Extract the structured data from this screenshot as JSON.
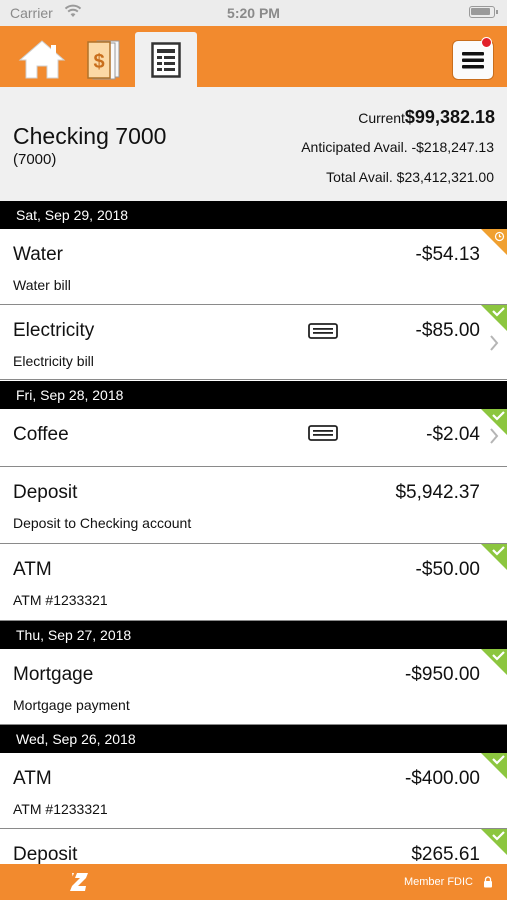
{
  "status_bar": {
    "carrier": "Carrier",
    "time": "5:20 PM"
  },
  "nav": {
    "icons": [
      "home-icon",
      "dollar-icon",
      "register-icon",
      "menu-icon"
    ],
    "accent_color": "#f28a2e",
    "notification_color": "#e2202a"
  },
  "account": {
    "name": "Checking 7000",
    "number": "(7000)",
    "current_label": "Current",
    "current_value": "$99,382.18",
    "anticipated": "Anticipated Avail. -$218,247.13",
    "total": "Total Avail. $23,412,321.00"
  },
  "dates": {
    "d1": "Sat, Sep 29, 2018",
    "d2": "Fri, Sep 28, 2018",
    "d3": "Thu, Sep 27, 2018",
    "d4": "Wed, Sep 26, 2018"
  },
  "transactions": [
    {
      "title": "Water",
      "memo": "Water bill",
      "amount": "-$54.13",
      "status": "pending"
    },
    {
      "title": "Electricity",
      "memo": "Electricity bill",
      "amount": "-$85.00",
      "status": "cleared"
    },
    {
      "title": "Coffee",
      "memo": "",
      "amount": "-$2.04",
      "status": "cleared"
    },
    {
      "title": "Deposit",
      "memo": "Deposit to Checking account",
      "amount": "$5,942.37",
      "status": "none"
    },
    {
      "title": "ATM",
      "memo": "ATM #1233321",
      "amount": "-$50.00",
      "status": "cleared"
    },
    {
      "title": "Mortgage",
      "memo": "Mortgage payment",
      "amount": "-$950.00",
      "status": "cleared"
    },
    {
      "title": "ATM",
      "memo": "ATM #1233321",
      "amount": "-$400.00",
      "status": "cleared"
    },
    {
      "title": "Deposit",
      "memo": "",
      "amount": "$265.61",
      "status": "cleared"
    }
  ],
  "status_colors": {
    "cleared": "#8cc63f",
    "pending": "#f0a030"
  },
  "footer": {
    "member_fdic": "Member FDIC"
  }
}
